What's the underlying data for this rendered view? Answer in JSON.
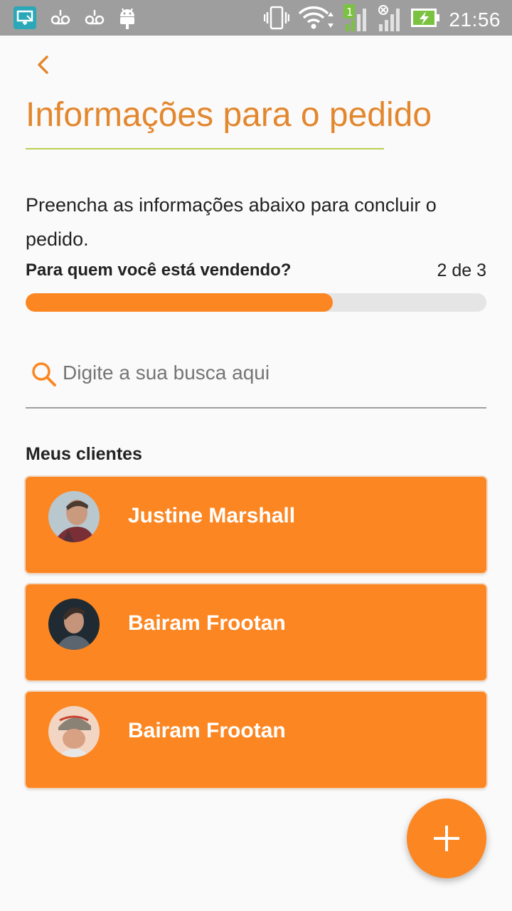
{
  "status_bar": {
    "time": "21:56",
    "icons": [
      "screen-mirror-icon",
      "voicemail-icon",
      "voicemail-icon",
      "android-icon",
      "vibrate-icon",
      "wifi-icon",
      "signal-sim1-icon",
      "signal-sim2-icon",
      "battery-charging-icon"
    ],
    "sim1_label": "1"
  },
  "header": {
    "back_icon": "chevron-left-icon",
    "title": "Informações para o pedido"
  },
  "instruction": "Preencha as informações abaixo para concluir o pedido.",
  "step": {
    "question": "Para quem você está vendendo?",
    "counter": "2 de 3",
    "progress": 0.6667
  },
  "search": {
    "icon": "search-icon",
    "placeholder": "Digite a sua busca aqui",
    "value": ""
  },
  "clients": {
    "heading": "Meus clientes",
    "items": [
      {
        "name": "Justine Marshall",
        "avatar": "avatar-photo"
      },
      {
        "name": "Bairam Frootan",
        "avatar": "avatar-photo"
      },
      {
        "name": "Bairam Frootan",
        "avatar": "avatar-photo"
      }
    ]
  },
  "fab": {
    "icon": "plus-icon"
  },
  "colors": {
    "accent": "#fc8622",
    "title": "#e3872e",
    "underline": "#b8cf54",
    "status_bar": "#9e9e9e",
    "progress_track": "#e5e5e5"
  }
}
